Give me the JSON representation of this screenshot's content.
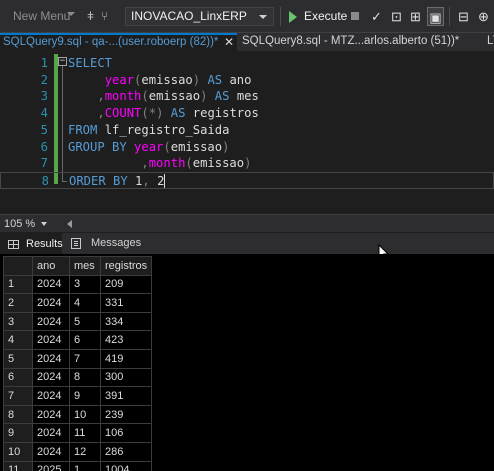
{
  "toolbar": {
    "new_menu_label": "New Menu",
    "database": "INOVACAO_LinxERP",
    "execute_label": "Execute"
  },
  "tabs": [
    {
      "label": "SQLQuery9.sql - qa-...(user.roboerp (82))*",
      "active": true,
      "close": "✕"
    },
    {
      "label": "SQLQuery8.sql - MTZ...arlos.alberto (51))*",
      "active": false
    },
    {
      "label": "L\\"
    }
  ],
  "editor": {
    "lines": [
      {
        "n": "1",
        "segments": [
          {
            "t": "SELECT",
            "c": "kw"
          }
        ]
      },
      {
        "n": "2",
        "segments": [
          {
            "t": "     ",
            "c": "tx"
          },
          {
            "t": "year",
            "c": "fn"
          },
          {
            "t": "(",
            "c": "gr"
          },
          {
            "t": "emissao",
            "c": "tx"
          },
          {
            "t": ")",
            "c": "gr"
          },
          {
            "t": " AS ",
            "c": "kw"
          },
          {
            "t": "ano",
            "c": "tx"
          }
        ]
      },
      {
        "n": "3",
        "segments": [
          {
            "t": "    ",
            "c": "tx"
          },
          {
            "t": ",",
            "c": "gr"
          },
          {
            "t": "month",
            "c": "fn"
          },
          {
            "t": "(",
            "c": "gr"
          },
          {
            "t": "emissao",
            "c": "tx"
          },
          {
            "t": ")",
            "c": "gr"
          },
          {
            "t": " AS ",
            "c": "kw"
          },
          {
            "t": "mes",
            "c": "tx"
          }
        ]
      },
      {
        "n": "4",
        "segments": [
          {
            "t": "    ",
            "c": "tx"
          },
          {
            "t": ",",
            "c": "gr"
          },
          {
            "t": "COUNT",
            "c": "fn"
          },
          {
            "t": "(",
            "c": "gr"
          },
          {
            "t": "*",
            "c": "gr"
          },
          {
            "t": ")",
            "c": "gr"
          },
          {
            "t": " AS ",
            "c": "kw"
          },
          {
            "t": "registros",
            "c": "tx"
          }
        ]
      },
      {
        "n": "5",
        "segments": [
          {
            "t": "FROM",
            "c": "kw"
          },
          {
            "t": " lf_registro_Saida",
            "c": "tx"
          }
        ]
      },
      {
        "n": "6",
        "segments": [
          {
            "t": "GROUP BY ",
            "c": "kw"
          },
          {
            "t": "year",
            "c": "fn"
          },
          {
            "t": "(",
            "c": "gr"
          },
          {
            "t": "emissao",
            "c": "tx"
          },
          {
            "t": ")",
            "c": "gr"
          }
        ]
      },
      {
        "n": "7",
        "segments": [
          {
            "t": "          ",
            "c": "tx"
          },
          {
            "t": ",",
            "c": "gr"
          },
          {
            "t": "month",
            "c": "fn"
          },
          {
            "t": "(",
            "c": "gr"
          },
          {
            "t": "emissao",
            "c": "tx"
          },
          {
            "t": ")",
            "c": "gr"
          }
        ]
      },
      {
        "n": "8",
        "segments": [
          {
            "t": "ORDER BY ",
            "c": "kw"
          },
          {
            "t": "1",
            "c": "tx"
          },
          {
            "t": ", ",
            "c": "gr"
          },
          {
            "t": "2",
            "c": "tx"
          }
        ]
      }
    ]
  },
  "zoom": {
    "value": "105 %"
  },
  "results_tabs": {
    "results_label": "Results",
    "messages_label": "Messages"
  },
  "results": {
    "columns": [
      "ano",
      "mes",
      "registros"
    ],
    "rows": [
      [
        "1",
        "2024",
        "3",
        "209"
      ],
      [
        "2",
        "2024",
        "4",
        "331"
      ],
      [
        "3",
        "2024",
        "5",
        "334"
      ],
      [
        "4",
        "2024",
        "6",
        "423"
      ],
      [
        "5",
        "2024",
        "7",
        "419"
      ],
      [
        "6",
        "2024",
        "8",
        "300"
      ],
      [
        "7",
        "2024",
        "9",
        "391"
      ],
      [
        "8",
        "2024",
        "10",
        "239"
      ],
      [
        "9",
        "2024",
        "11",
        "106"
      ],
      [
        "10",
        "2024",
        "12",
        "286"
      ],
      [
        "11",
        "2025",
        "1",
        "1004"
      ]
    ]
  },
  "colors": {
    "accent": "#007acc",
    "keyword": "#569cd6",
    "function": "#ff00ff",
    "line_number": "#2b91af"
  }
}
